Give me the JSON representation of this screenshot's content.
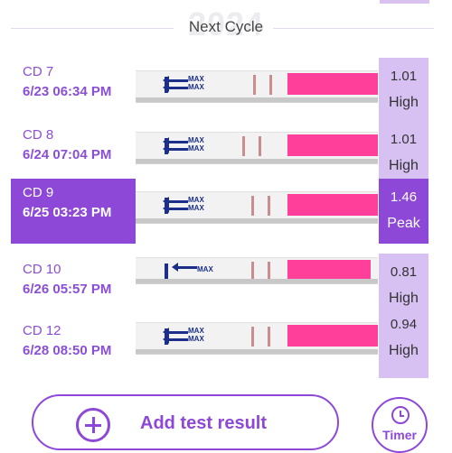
{
  "header": {
    "title": "Next Cycle",
    "ghost_year": "2024"
  },
  "rows": [
    {
      "cd": "CD 7",
      "datetime": "6/23   06:34 PM",
      "value": "1.01",
      "label": "High",
      "selected": false
    },
    {
      "cd": "CD 8",
      "datetime": "6/24   07:04 PM",
      "value": "1.01",
      "label": "High",
      "selected": false
    },
    {
      "cd": "CD 9",
      "datetime": "6/25   03:23 PM",
      "value": "1.46",
      "label": "Peak",
      "selected": true
    },
    {
      "cd": "CD 10",
      "datetime": "6/26   05:57 PM",
      "value": "0.81",
      "label": "High",
      "selected": false
    },
    {
      "cd": "CD 12",
      "datetime": "6/28   08:50 PM",
      "value": "0.94",
      "label": "High",
      "selected": false
    }
  ],
  "strip_text": "MAX",
  "actions": {
    "add_label": "Add test result",
    "timer_label": "Timer"
  },
  "colors": {
    "accent": "#8e48d8",
    "result_bg": "#d7c0f2",
    "strip_pink": "#ff3f9a"
  },
  "icons": {
    "add": "plus-circle-icon",
    "timer": "clock-icon"
  }
}
